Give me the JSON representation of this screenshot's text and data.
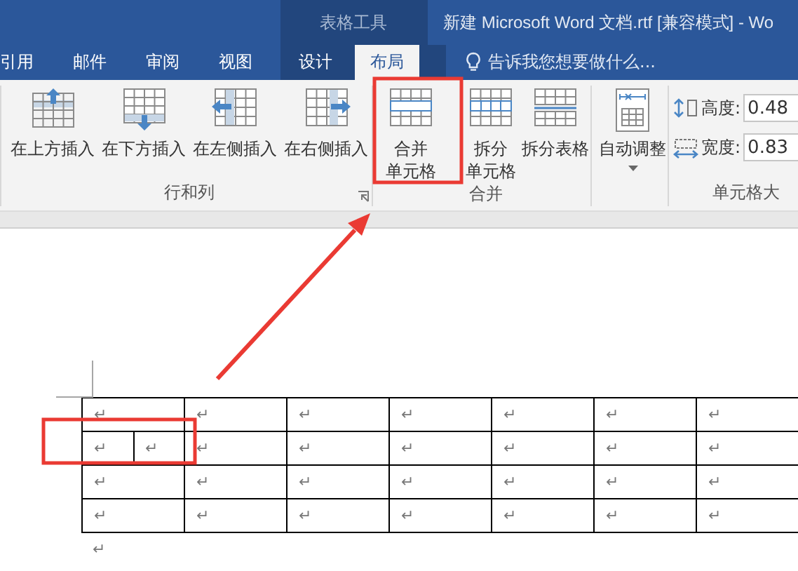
{
  "title_bar": {
    "context_label": "表格工具",
    "title": "新建 Microsoft Word 文档.rtf [兼容模式] - Wo"
  },
  "tabs": [
    {
      "label": "引用",
      "selected": false,
      "contextual": false
    },
    {
      "label": "邮件",
      "selected": false,
      "contextual": false
    },
    {
      "label": "审阅",
      "selected": false,
      "contextual": false
    },
    {
      "label": "视图",
      "selected": false,
      "contextual": false
    },
    {
      "label": "设计",
      "selected": false,
      "contextual": true
    },
    {
      "label": "布局",
      "selected": true,
      "contextual": true
    }
  ],
  "tell_me": {
    "placeholder": "告诉我您想要做什么..."
  },
  "ribbon_groups": [
    {
      "label": "行和列",
      "launcher": true,
      "buttons": [
        {
          "label": "在上方插入"
        },
        {
          "label": "在下方插入"
        },
        {
          "label": "在左侧插入"
        },
        {
          "label": "在右侧插入"
        }
      ]
    },
    {
      "label": "合并",
      "launcher": false,
      "buttons": [
        {
          "label": "合并单元格"
        },
        {
          "label": "拆分单元格"
        },
        {
          "label": "拆分表格"
        }
      ]
    },
    {
      "launcher": false,
      "buttons": [
        {
          "label": "自动调整",
          "dropdown": true
        }
      ]
    }
  ],
  "cell_size": {
    "label": "单元格大",
    "fields": [
      {
        "label": "高度:",
        "value": "0.48"
      },
      {
        "label": "宽度:",
        "value": "0.83"
      }
    ]
  },
  "table": {
    "rows": [
      {
        "cells": [
          {
            "text": "↵",
            "colspan": 2
          },
          {
            "text": "↵"
          },
          {
            "text": "↵"
          },
          {
            "text": "↵"
          },
          {
            "text": "↵"
          },
          {
            "text": "↵"
          },
          {
            "text": "↵"
          }
        ]
      },
      {
        "cells": [
          {
            "text": "↵"
          },
          {
            "text": "↵"
          },
          {
            "text": "↵"
          },
          {
            "text": "↵"
          },
          {
            "text": "↵"
          },
          {
            "text": "↵"
          },
          {
            "text": "↵"
          },
          {
            "text": "↵"
          }
        ]
      },
      {
        "cells": [
          {
            "text": "↵",
            "colspan": 2
          },
          {
            "text": "↵"
          },
          {
            "text": "↵"
          },
          {
            "text": "↵"
          },
          {
            "text": "↵"
          },
          {
            "text": "↵"
          },
          {
            "text": "↵"
          }
        ]
      },
      {
        "cells": [
          {
            "text": "↵",
            "colspan": 2
          },
          {
            "text": "↵"
          },
          {
            "text": "↵"
          },
          {
            "text": "↵"
          },
          {
            "text": "↵"
          },
          {
            "text": "↵"
          },
          {
            "text": "↵"
          }
        ]
      }
    ]
  },
  "end_mark": "↵"
}
